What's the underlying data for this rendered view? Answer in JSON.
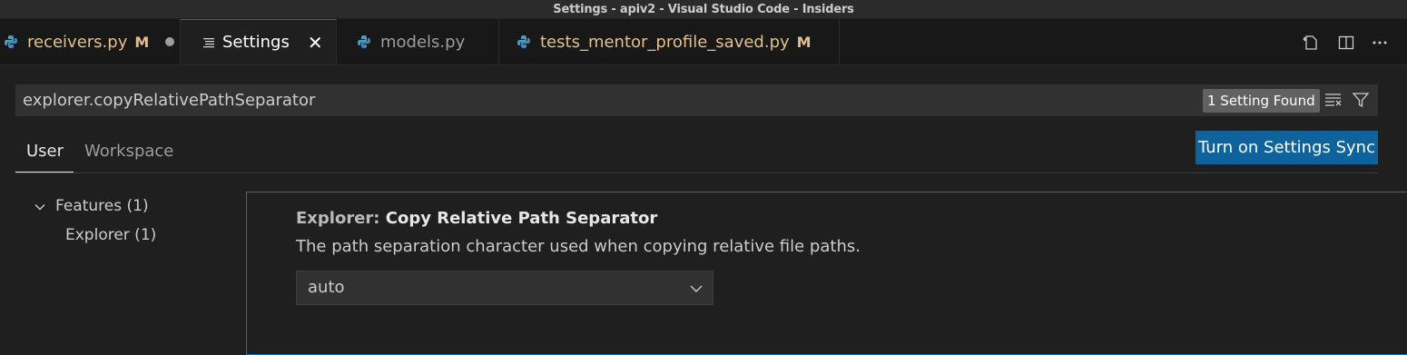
{
  "window": {
    "title": "Settings - apiv2 - Visual Studio Code - Insiders"
  },
  "tabs": [
    {
      "label": "receivers.py",
      "status": "M",
      "icon": "python-icon"
    },
    {
      "label": "Settings",
      "icon": "settings-lines-icon",
      "active": true
    },
    {
      "label": "models.py",
      "icon": "python-icon"
    },
    {
      "label": "tests_mentor_profile_saved.py",
      "status": "M",
      "icon": "python-icon"
    }
  ],
  "toolbar": {
    "icons": [
      "open-settings-json-icon",
      "split-editor-icon",
      "more-actions-icon"
    ]
  },
  "search": {
    "value": "explorer.copyRelativePathSeparator",
    "result_badge": "1 Setting Found"
  },
  "scope_tabs": {
    "user": "User",
    "workspace": "Workspace"
  },
  "sync_button": "Turn on Settings Sync",
  "toc": {
    "features": "Features (1)",
    "explorer": "Explorer (1)"
  },
  "setting": {
    "category": "Explorer: ",
    "label": "Copy Relative Path Separator",
    "description": "The path separation character used when copying relative file paths.",
    "value": "auto"
  },
  "colors": {
    "accent": "#0078d4",
    "button": "#0e639c",
    "modified": "#e2c08d"
  }
}
